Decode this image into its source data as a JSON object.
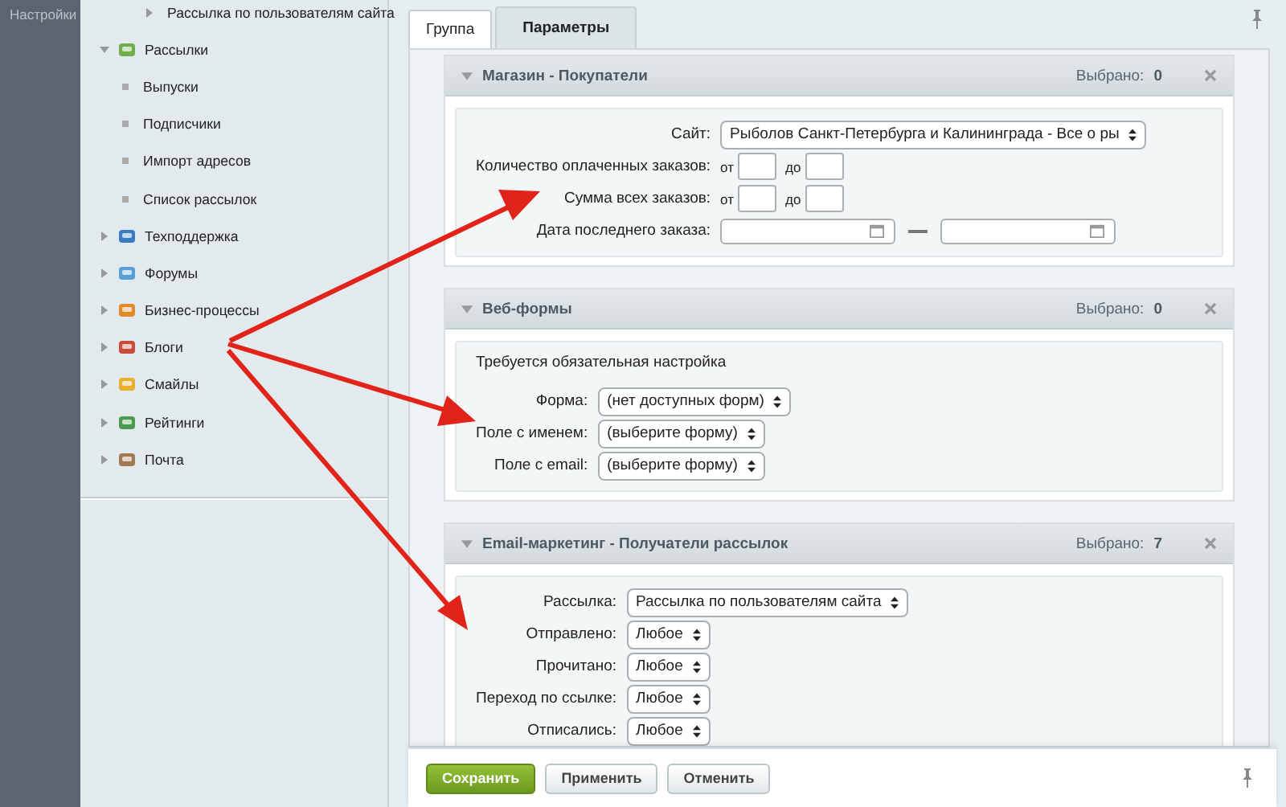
{
  "left_bar": {
    "label": "Настройки"
  },
  "sidebar": {
    "items": [
      {
        "label": "Рассылка по пользователям сайта",
        "kind": "sub",
        "expanded": false
      },
      {
        "label": "Рассылки",
        "kind": "group",
        "expanded": true,
        "children": [
          {
            "label": "Выпуски",
            "kind": "page"
          },
          {
            "label": "Подписчики",
            "kind": "page"
          },
          {
            "label": "Импорт адресов",
            "kind": "page"
          },
          {
            "label": "Список рассылок",
            "kind": "page"
          }
        ]
      },
      {
        "label": "Техподдержка",
        "kind": "group",
        "expanded": false
      },
      {
        "label": "Форумы",
        "kind": "group",
        "expanded": false
      },
      {
        "label": "Бизнес-процессы",
        "kind": "group",
        "expanded": false
      },
      {
        "label": "Блоги",
        "kind": "group",
        "expanded": false
      },
      {
        "label": "Смайлы",
        "kind": "group",
        "expanded": false
      },
      {
        "label": "Рейтинги",
        "kind": "group",
        "expanded": false
      },
      {
        "label": "Почта",
        "kind": "group",
        "expanded": false
      }
    ]
  },
  "tabs": [
    {
      "label": "Группа",
      "selected": false
    },
    {
      "label": "Параметры",
      "selected": true
    }
  ],
  "sections": [
    {
      "title": "Магазин - Покупатели",
      "expanded": true,
      "selected_label": "Выбрано:",
      "count": "0",
      "fields": [
        {
          "kind": "select",
          "label": "Сайт:",
          "value": "Рыболов Санкт-Петербурга и Калининграда - Все о ры"
        },
        {
          "kind": "range",
          "label": "Количество оплаченных заказов:",
          "from_label": "от",
          "to_label": "до"
        },
        {
          "kind": "range",
          "label": "Сумма всех заказов:",
          "from_label": "от",
          "to_label": "до"
        },
        {
          "kind": "daterange",
          "label": "Дата последнего заказа:"
        }
      ]
    },
    {
      "title": "Веб-формы",
      "expanded": true,
      "selected_label": "Выбрано:",
      "count": "0",
      "note": "Требуется обязательная настройка",
      "fields": [
        {
          "kind": "select",
          "label": "Форма:",
          "value": "(нет доступных форм)"
        },
        {
          "kind": "select",
          "label": "Поле с именем:",
          "value": "(выберите форму)"
        },
        {
          "kind": "select",
          "label": "Поле с email:",
          "value": "(выберите форму)"
        }
      ]
    },
    {
      "title": "Email-маркетинг - Получатели рассылок",
      "expanded": true,
      "selected_label": "Выбрано:",
      "count": "7",
      "fields": [
        {
          "kind": "select",
          "label": "Рассылка:",
          "value": "Рассылка по пользователям сайта"
        },
        {
          "kind": "select",
          "label": "Отправлено:",
          "value": "Любое"
        },
        {
          "kind": "select",
          "label": "Прочитано:",
          "value": "Любое"
        },
        {
          "kind": "select",
          "label": "Переход по ссылке:",
          "value": "Любое"
        },
        {
          "kind": "select",
          "label": "Отписались:",
          "value": "Любое"
        }
      ]
    }
  ],
  "footer": {
    "buttons": [
      {
        "label": "Сохранить",
        "kind": "primary"
      },
      {
        "label": "Применить",
        "kind": "secondary"
      },
      {
        "label": "Отменить",
        "kind": "secondary"
      }
    ]
  }
}
